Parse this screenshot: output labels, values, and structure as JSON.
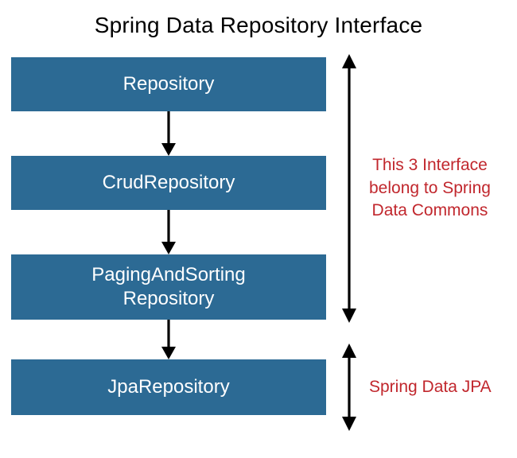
{
  "title": "Spring Data Repository Interface",
  "boxes": {
    "b1": "Repository",
    "b2": "CrudRepository",
    "b3_line1": "PagingAndSorting",
    "b3_line2": "Repository",
    "b4": "JpaRepository"
  },
  "annotations": {
    "top_line1": "This 3 Interface",
    "top_line2": "belong to Spring",
    "top_line3": "Data Commons",
    "bottom": "Spring Data JPA"
  },
  "colors": {
    "box_bg": "#2c6a94",
    "box_text": "#ffffff",
    "annotation": "#c1272d",
    "arrow": "#000000"
  }
}
